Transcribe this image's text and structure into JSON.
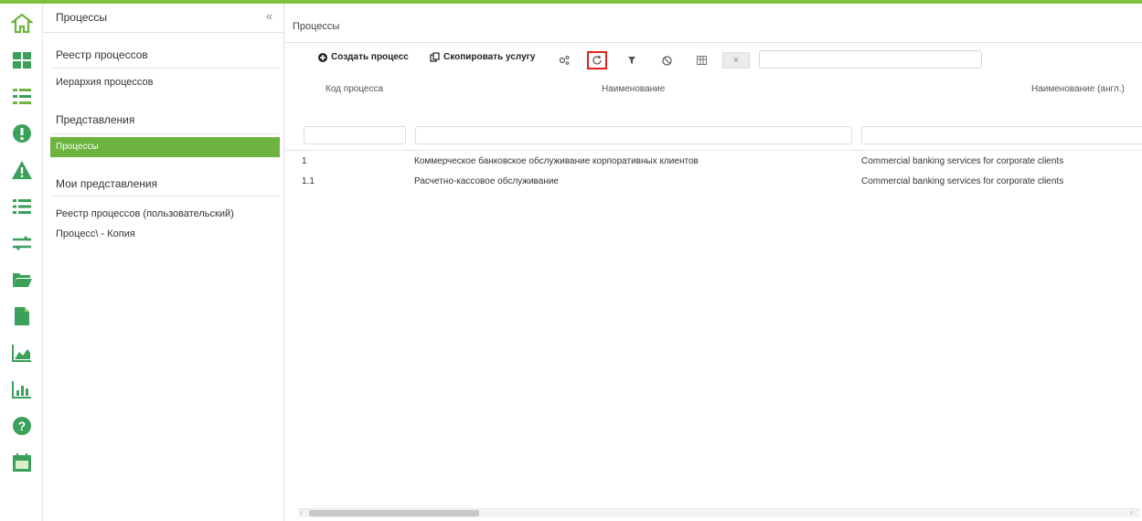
{
  "colors": {
    "accent": "#6db33f",
    "highlight": "#e0201e"
  },
  "rail": {
    "items": [
      "home-icon",
      "dashboard-icon",
      "registry-list-icon",
      "alert-circle-icon",
      "warning-icon",
      "list-icon",
      "exchange-icon",
      "folder-icon",
      "document-icon",
      "area-chart-icon",
      "bar-chart-icon",
      "help-icon",
      "calendar-icon"
    ]
  },
  "sidebar": {
    "title": "Процессы",
    "collapse": "«",
    "registry": "Реестр процессов",
    "hierarchy": "Иерархия процессов",
    "views_section": "Представления",
    "active_view": "Процессы",
    "my_views_section": "Мои представления",
    "my_views": [
      "Реестр процессов (пользовательский)",
      "Процесс\\ - Копия"
    ]
  },
  "main": {
    "breadcrumb": "Процессы",
    "toolbar": {
      "create": "Создать процесс",
      "copy": "Скопировать услугу",
      "icons": [
        "settings-icon",
        "refresh-icon",
        "filter-icon",
        "block-icon",
        "columns-icon"
      ],
      "clear": "×",
      "search_value": ""
    },
    "columns": [
      "Код процесса",
      "Наименование",
      "Наименование (англ.)"
    ],
    "rows": [
      {
        "code": "1",
        "name": "Коммерческое банковское обслуживание корпоративных клиентов",
        "name_en": "Commercial banking services for corporate clients"
      },
      {
        "code": "1.1",
        "name": "Расчетно-кассовое обслуживание",
        "name_en": "Commercial banking services for corporate clients"
      }
    ],
    "scroll": {
      "left": "‹",
      "right": "›"
    }
  }
}
